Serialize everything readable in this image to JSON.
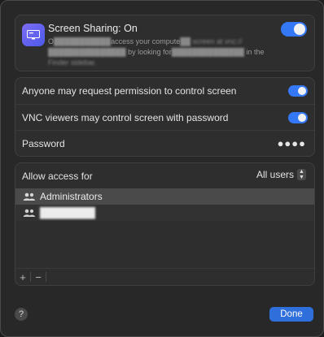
{
  "screen_sharing": {
    "title": "Screen Sharing: On",
    "desc_line1_pre": "O",
    "desc_line1_redacted": "███████████",
    "desc_line1_mid": "access your compute",
    "desc_line1_redacted2": "██ screen at vnc://",
    "desc_line2_redacted": "███████████████",
    "desc_line2_mid": " by looking for",
    "desc_line2_redacted2": "██████████████",
    "desc_line2_post": " in the",
    "desc_line3": "Finder sidebar.",
    "enabled": true
  },
  "settings": {
    "request_permission_label": "Anyone may request permission to control screen",
    "vnc_password_label": "VNC viewers may control screen with password",
    "password_label": "Password",
    "password_value": "●●●●"
  },
  "access": {
    "label": "Allow access for",
    "selected_option": "All users",
    "users": [
      {
        "name": "Administrators",
        "selected": true
      },
      {
        "name": "████████",
        "selected": false
      }
    ],
    "add_label": "+",
    "remove_label": "−"
  },
  "footer": {
    "help_label": "?",
    "done_label": "Done"
  },
  "colors": {
    "accent": "#3478f6",
    "done_button": "#2f6fdc"
  }
}
